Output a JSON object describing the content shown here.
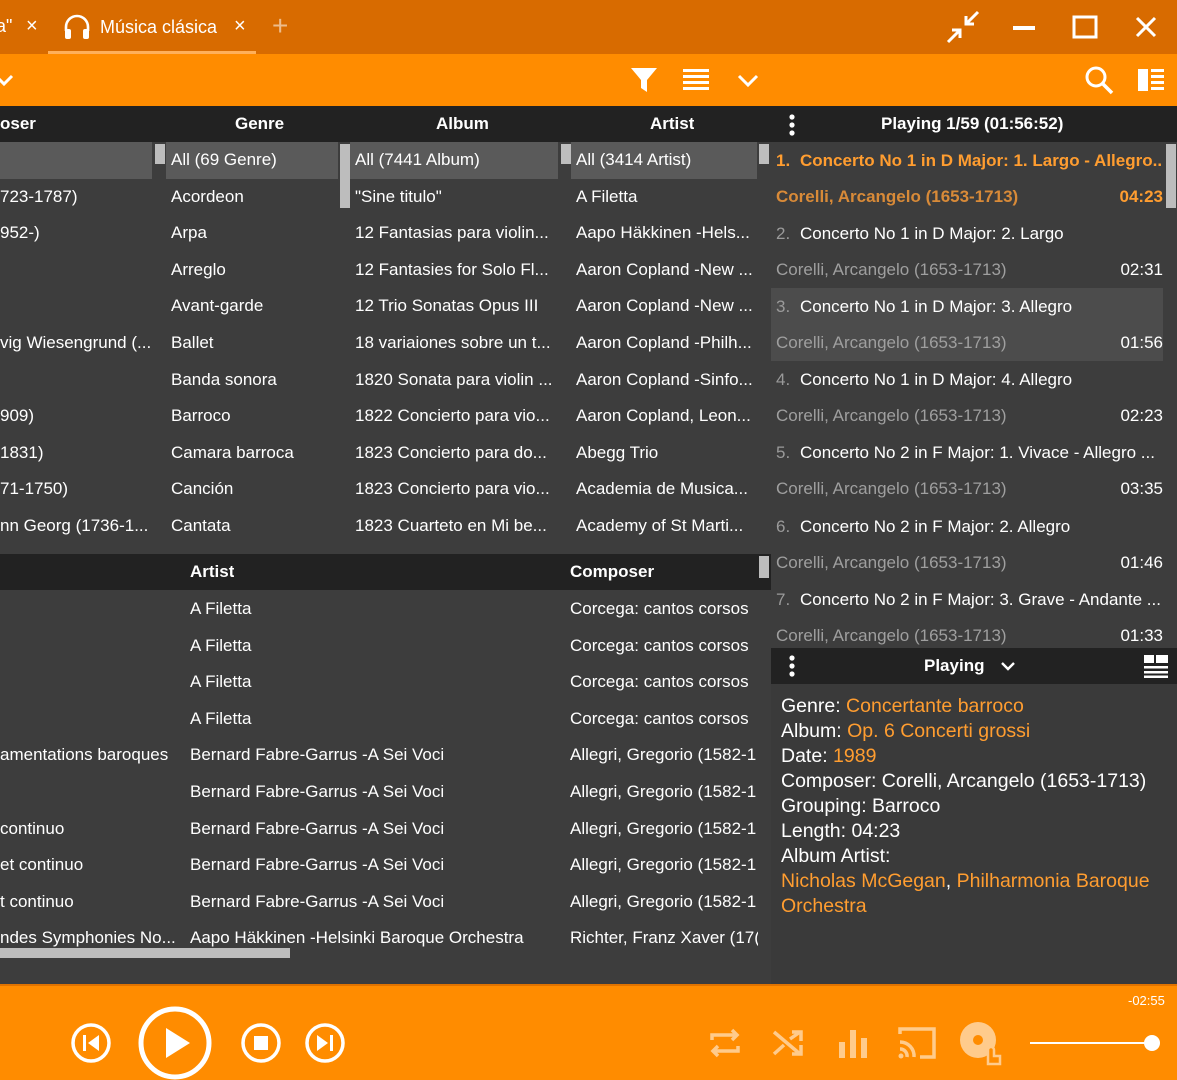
{
  "titlebar": {
    "prev_tab_fragment": "a\"",
    "active_tab_label": "Música clásica",
    "close_glyph": "×",
    "add_glyph": "+"
  },
  "browser": {
    "columns": [
      "oser",
      "Genre",
      "Album",
      "Artist"
    ],
    "composer": [
      "",
      "723-1787)",
      "952-)",
      "",
      "",
      "vig Wiesengrund (...",
      "",
      "909)",
      "1831)",
      "71-1750)",
      "nn Georg (1736-1..."
    ],
    "genre": [
      "All (69 Genre)",
      "Acordeon",
      "Arpa",
      "Arreglo",
      "Avant-garde",
      "Ballet",
      "Banda sonora",
      "Barroco",
      "Camara barroca",
      "Canción",
      "Cantata"
    ],
    "album": [
      "All (7441 Album)",
      "\"Sine titulo\"",
      "12 Fantasias para violin...",
      "12 Fantasies for Solo Fl...",
      "12 Trio Sonatas Opus III",
      "18 variaiones sobre un t...",
      "1820 Sonata para violin ...",
      "1822 Concierto para vio...",
      "1823 Concierto para do...",
      "1823 Concierto para vio...",
      "1823 Cuarteto en Mi be..."
    ],
    "artist": [
      "All (3414 Artist)",
      "A Filetta",
      "Aapo Häkkinen -Hels...",
      "Aaron Copland -New ...",
      "Aaron Copland -New ...",
      "Aaron Copland -Philh...",
      "Aaron Copland -Sinfo...",
      "Aaron Copland, Leon...",
      "Abegg Trio",
      "Academia de Musica...",
      "Academy of St Marti..."
    ]
  },
  "tracklist": {
    "columns": [
      "Artist",
      "Composer"
    ],
    "title": [
      "",
      "",
      "",
      "",
      "amentations baroques",
      "",
      "continuo",
      "et continuo",
      "t continuo",
      "ndes Symphonies No..."
    ],
    "artist": [
      "A Filetta",
      "A Filetta",
      "A Filetta",
      "A Filetta",
      "Bernard Fabre-Garrus -A Sei Voci",
      "Bernard Fabre-Garrus -A Sei Voci",
      "Bernard Fabre-Garrus -A Sei Voci",
      "Bernard Fabre-Garrus -A Sei Voci",
      "Bernard Fabre-Garrus -A Sei Voci",
      "Aapo Häkkinen -Helsinki Baroque Orchestra"
    ],
    "composer": [
      "Corcega: cantos corsos",
      "Corcega: cantos corsos",
      "Corcega: cantos corsos",
      "Corcega: cantos corsos",
      "Allegri, Gregorio (1582-1",
      "Allegri, Gregorio (1582-1",
      "Allegri, Gregorio (1582-1",
      "Allegri, Gregorio (1582-1",
      "Allegri, Gregorio (1582-1",
      "Richter, Franz Xaver (17("
    ]
  },
  "playlist": {
    "header": "Playing 1/59 (01:56:52)",
    "tracks": [
      {
        "num": "1.",
        "title": "Concerto No 1 in D Major: 1. Largo - Allegro...",
        "composer": "Corelli, Arcangelo (1653-1713)",
        "duration": "04:23"
      },
      {
        "num": "2.",
        "title": "Concerto No 1 in D Major: 2. Largo",
        "composer": "Corelli, Arcangelo (1653-1713)",
        "duration": "02:31"
      },
      {
        "num": "3.",
        "title": "Concerto No 1 in D Major: 3. Allegro",
        "composer": "Corelli, Arcangelo (1653-1713)",
        "duration": "01:56"
      },
      {
        "num": "4.",
        "title": "Concerto No 1 in D Major: 4. Allegro",
        "composer": "Corelli, Arcangelo (1653-1713)",
        "duration": "02:23"
      },
      {
        "num": "5.",
        "title": "Concerto No 2 in F Major: 1. Vivace - Allegro ...",
        "composer": "Corelli, Arcangelo (1653-1713)",
        "duration": "03:35"
      },
      {
        "num": "6.",
        "title": "Concerto No 2 in F Major: 2. Allegro",
        "composer": "Corelli, Arcangelo (1653-1713)",
        "duration": "01:46"
      },
      {
        "num": "7.",
        "title": "Concerto No 2 in F Major: 3. Grave - Andante ...",
        "composer": "Corelli, Arcangelo (1653-1713)",
        "duration": "01:33"
      }
    ]
  },
  "nowplaying": {
    "header": "Playing",
    "genre_label": "Genre: ",
    "genre": "Concertante barroco",
    "album_label": "Album: ",
    "album": "Op. 6 Concerti grossi",
    "date_label": "Date: ",
    "date": "1989",
    "composer_line": "Composer: Corelli, Arcangelo (1653-1713)",
    "grouping_line": "Grouping: Barroco",
    "length_line": "Length: 04:23",
    "album_artist_label": "Album Artist:",
    "album_artist_1": "Nicholas McGegan",
    "album_artist_sep": ", ",
    "album_artist_2": "Philharmonia Baroque",
    "album_artist_3": "Orchestra"
  },
  "transport": {
    "remaining": "-02:55",
    "volume_fraction": 0.97
  },
  "colors": {
    "accent": "#ff8c00",
    "titlebar": "#d86b00",
    "highlight_text": "#ff9d30"
  }
}
